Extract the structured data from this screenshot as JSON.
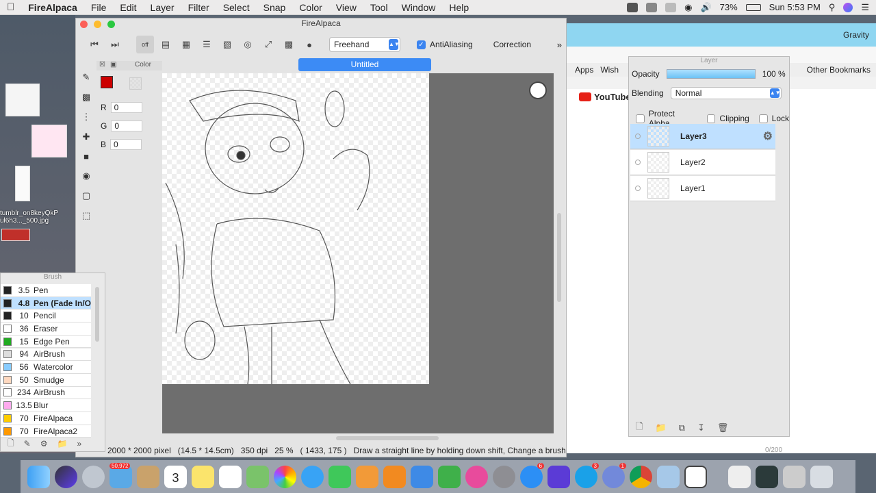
{
  "menubar": {
    "app": "FireAlpaca",
    "items": [
      "File",
      "Edit",
      "Layer",
      "Filter",
      "Select",
      "Snap",
      "Color",
      "View",
      "Tool",
      "Window",
      "Help"
    ],
    "battery": "73%",
    "clock": "Sun 5:53 PM"
  },
  "desktop": {
    "file1": "tumblr_on8keyQkP ul6h3..._500.jpg"
  },
  "browser": {
    "tab": "Gravity",
    "bookmarks": [
      "Apps",
      "Wish",
      "Other Bookmarks"
    ],
    "site": "YouTube",
    "counter": "0/200"
  },
  "window": {
    "title": "FireAlpaca",
    "doc_tab": "Untitled"
  },
  "toolbar": {
    "mode": "Freehand",
    "antialias_label": "AntiAliasing",
    "antialias_checked": true,
    "correction_label": "Correction"
  },
  "color": {
    "title": "Color",
    "r_label": "R",
    "r": "0",
    "g_label": "G",
    "g": "0",
    "b_label": "B",
    "b": "0",
    "primary": "#ff0000"
  },
  "status": {
    "size": "2000 * 2000 pixel",
    "physical": "(14.5 * 14.5cm)",
    "dpi": "350 dpi",
    "zoom": "25 %",
    "coords": "( 1433, 175 )",
    "hint": "Draw a straight line by holding down shift, Change a brush"
  },
  "brush": {
    "title": "Brush",
    "items": [
      {
        "size": "3.5",
        "name": "Pen",
        "color": "#222222"
      },
      {
        "size": "4.8",
        "name": "Pen (Fade In/Out)",
        "color": "#222222",
        "selected": true
      },
      {
        "size": "10",
        "name": "Pencil",
        "color": "#222222"
      },
      {
        "size": "36",
        "name": "Eraser",
        "color": "#ffffff"
      },
      {
        "size": "15",
        "name": "Edge Pen",
        "color": "#22aa22"
      },
      {
        "size": "94",
        "name": "AirBrush",
        "color": "#dddddd"
      },
      {
        "size": "56",
        "name": "Watercolor",
        "color": "#88ccff"
      },
      {
        "size": "50",
        "name": "Smudge",
        "color": "#ffd9c0"
      },
      {
        "size": "234",
        "name": "AirBrush",
        "color": "#ffffff"
      },
      {
        "size": "13.5",
        "name": "Blur",
        "color": "#ffaaee"
      },
      {
        "size": "70",
        "name": "FireAlpaca",
        "color": "#ffcc00"
      },
      {
        "size": "70",
        "name": "FireAlpaca2",
        "color": "#ff9900"
      }
    ]
  },
  "layer": {
    "title": "Layer",
    "opacity_label": "Opacity",
    "opacity_value": "100 %",
    "opacity_fraction": 1.0,
    "blending_label": "Blending",
    "blending_value": "Normal",
    "protect_alpha": "Protect Alpha",
    "clipping": "Clipping",
    "lock": "Lock",
    "layers": [
      {
        "name": "Layer3",
        "selected": true
      },
      {
        "name": "Layer2"
      },
      {
        "name": "Layer1"
      }
    ]
  },
  "dock": {
    "badge_mail": "50,972",
    "calendar_day": "3",
    "badge_messages": "6",
    "badge_skype": "3",
    "badge_discord": "1"
  }
}
